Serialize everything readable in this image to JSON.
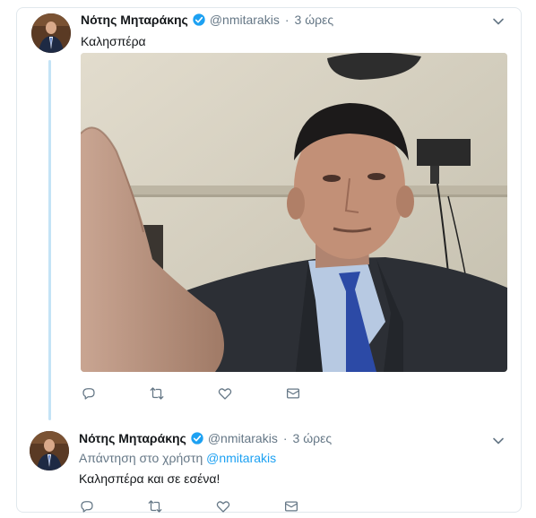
{
  "tweets": [
    {
      "author_name": "Νότης Μηταράκης",
      "handle": "@nmitarakis",
      "separator": "·",
      "time": "3 ώρες",
      "text": "Καλησπέρα"
    },
    {
      "author_name": "Νότης Μηταράκης",
      "handle": "@nmitarakis",
      "separator": "·",
      "time": "3 ώρες",
      "replying_to_label": "Απάντηση στο χρήστη",
      "replying_to_handle": "@nmitarakis",
      "text": "Καλησπέρα και σε εσένα!"
    }
  ],
  "icons": {
    "verified": "verified-badge-icon",
    "caret": "chevron-down-icon",
    "reply": "reply-icon",
    "retweet": "retweet-icon",
    "like": "heart-icon",
    "dm": "envelope-icon"
  },
  "colors": {
    "accent": "#1da1f2",
    "secondary_text": "#657786",
    "thread_line": "#c4e3f6",
    "border": "#e1e8ed"
  }
}
